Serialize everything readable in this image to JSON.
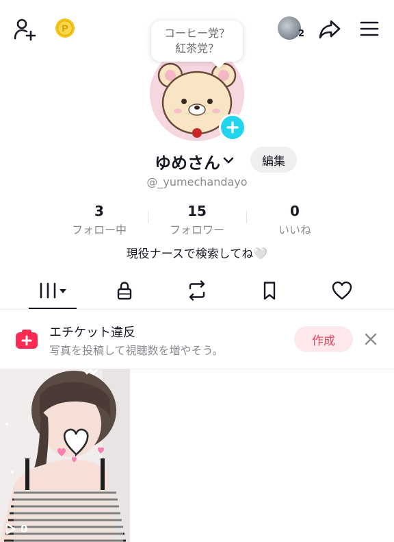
{
  "header": {
    "add_friend_icon": "person-add-icon",
    "coin_icon": "coin-icon",
    "visitor_count": "2",
    "share_icon": "share-icon",
    "menu_icon": "hamburger-menu-icon"
  },
  "bubble": {
    "line1": "コーヒー党？",
    "line2": "紅茶党？"
  },
  "profile": {
    "name": "ゆめさん",
    "edit_label": "編集",
    "handle": "@_yumechandayo",
    "bio": "現役ナースで検索してね🤍"
  },
  "stats": [
    {
      "value": "3",
      "label": "フォロー中"
    },
    {
      "value": "15",
      "label": "フォロワー"
    },
    {
      "value": "0",
      "label": "いいね"
    }
  ],
  "banner": {
    "title": "エチケット違反",
    "subtitle": "写真を投稿して視聴数を増やそう。",
    "create_label": "作成"
  },
  "videos": [
    {
      "views": "0"
    }
  ],
  "colors": {
    "accent_cyan": "#20d5ec",
    "create_pink": "#e6475f",
    "banner_icon_red": "#fe2c55",
    "coin_gold": "#f5c518"
  }
}
